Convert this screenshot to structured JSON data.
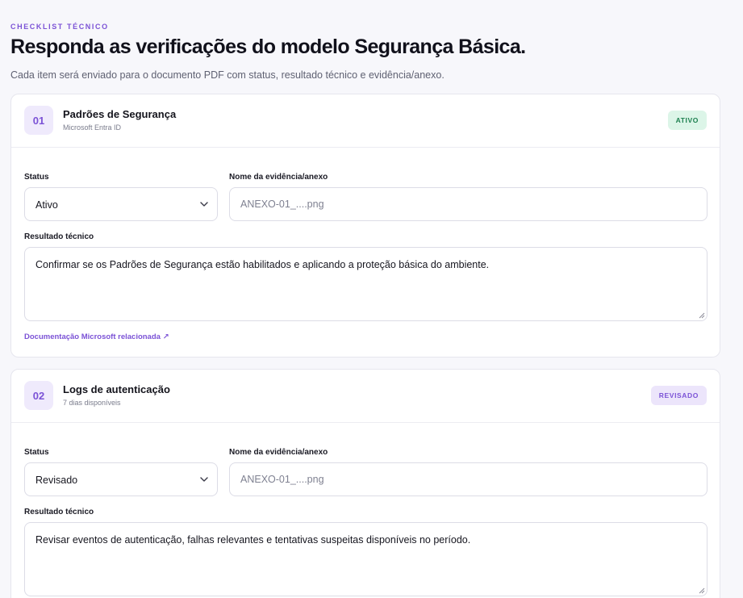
{
  "header": {
    "eyebrow": "CHECKLIST TÉCNICO",
    "title": "Responda as verificações do modelo Segurança Básica.",
    "subtitle": "Cada item será enviado para o documento PDF com status, resultado técnico e evidência/anexo."
  },
  "labels": {
    "status": "Status",
    "evidence": "Nome da evidência/anexo",
    "result": "Resultado técnico"
  },
  "items": [
    {
      "number": "01",
      "title": "Padrões de Segurança",
      "subtitle": "Microsoft Entra ID",
      "badge": "ATIVO",
      "status_value": "Ativo",
      "evidence_placeholder": "ANEXO-01_....png",
      "result_text": "Confirmar se os Padrões de Segurança estão habilitados e aplicando a proteção básica do ambiente.",
      "link_text": "Documentação Microsoft relacionada ↗"
    },
    {
      "number": "02",
      "title": "Logs de autenticação",
      "subtitle": "7 dias disponíveis",
      "badge": "REVISADO",
      "status_value": "Revisado",
      "evidence_placeholder": "ANEXO-01_....png",
      "result_text": "Revisar eventos de autenticação, falhas relevantes e tentativas suspeitas disponíveis no período."
    }
  ],
  "icons": {
    "select": "chevron-down-icon",
    "textarea": "resize-grip-icon"
  },
  "colors": {
    "accent": "#7b52d6",
    "active_bg": "#dcf5e8",
    "active_fg": "#1b7f4e",
    "reviewed_bg": "#ece5fb"
  }
}
